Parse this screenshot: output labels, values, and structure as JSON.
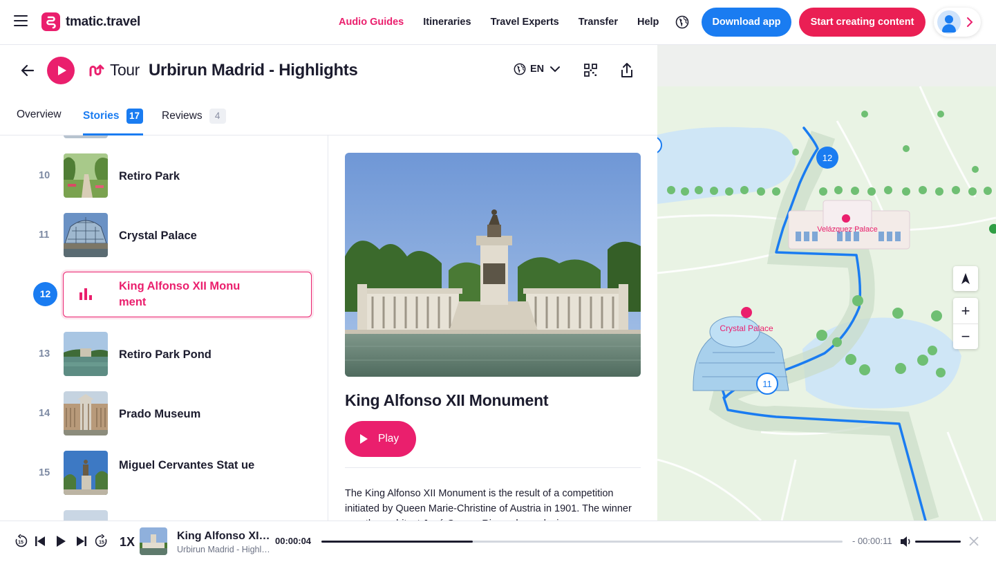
{
  "brand": {
    "name": "tmatic.travel",
    "accent": "#ea1f6d",
    "primary": "#1a7cf1"
  },
  "nav": {
    "items": [
      {
        "label": "Audio Guides",
        "active": true
      },
      {
        "label": "Itineraries",
        "active": false
      },
      {
        "label": "Travel Experts",
        "active": false
      },
      {
        "label": "Transfer",
        "active": false
      },
      {
        "label": "Help",
        "active": false
      }
    ],
    "download_label": "Download app",
    "create_label": "Start creating content"
  },
  "tour": {
    "tag": "Tour",
    "title": "Urbirun Madrid - Highlights",
    "language": "EN"
  },
  "tabs": {
    "overview": "Overview",
    "stories": "Stories",
    "stories_count": "17",
    "reviews": "Reviews",
    "reviews_count": "4"
  },
  "stories": [
    {
      "num": "10",
      "name": "Retiro Park"
    },
    {
      "num": "11",
      "name": "Crystal Palace"
    },
    {
      "num": "12",
      "name": "King Alfonso XII Monu ment",
      "active": true
    },
    {
      "num": "13",
      "name": "Retiro Park Pond"
    },
    {
      "num": "14",
      "name": "Prado Museum"
    },
    {
      "num": "15",
      "name": "Miguel Cervantes Stat ue"
    }
  ],
  "detail": {
    "title": "King Alfonso XII Monument",
    "play_label": "Play",
    "description": "The King Alfonso XII Monument is the result of a competition initiated by Queen Marie-Christine of Austria in 1901. The winner was the architect José Grases Riera whose design"
  },
  "map": {
    "labels": {
      "velazquez": "Velázquez Palace",
      "crystal": "Crystal Palace"
    },
    "markers": {
      "current": "12",
      "previous": "11"
    },
    "zoom_in": "+",
    "zoom_out": "−"
  },
  "player": {
    "speed": "1X",
    "title": "King Alfonso XII Monument",
    "subtitle": "Urbirun Madrid - Highlights",
    "elapsed": "00:00:04",
    "remaining": "- 00:00:11",
    "progress": 0.29,
    "volume": 1.0,
    "skip_seconds": "15"
  }
}
